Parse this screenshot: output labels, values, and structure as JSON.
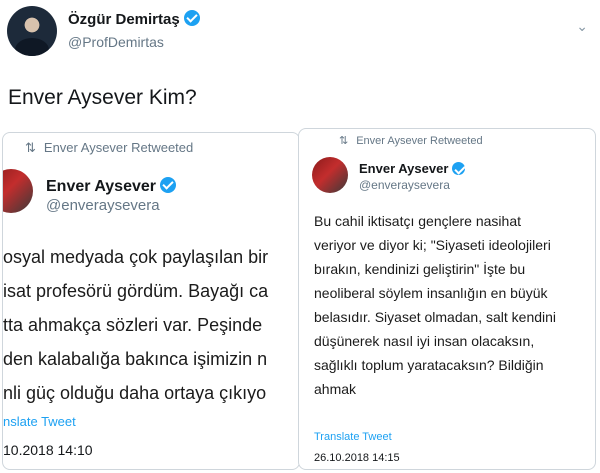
{
  "tweet": {
    "author_name": "Özgür Demirtaş",
    "author_handle": "@ProfDemirtas",
    "text": "Enver Aysever Kim?",
    "menu_icon": "chevron-down-icon"
  },
  "left_card": {
    "retweet_label": "Enver Aysever Retweeted",
    "author_name": "Enver Aysever",
    "author_handle": "@enveraysevera",
    "lines": [
      "osyal medyada çok paylaşılan bir",
      "isat profesörü gördüm. Bayağı ca",
      "tta ahmakça sözleri var. Peşinde",
      "den kalabalığa bakınca işimizin n",
      "nli güç olduğu daha ortaya çıkıyo"
    ],
    "translate_label": "nslate Tweet",
    "date": "10.2018 14:10"
  },
  "right_card": {
    "retweet_label": "Enver Aysever Retweeted",
    "author_name": "Enver Aysever",
    "author_handle": "@enveraysevera",
    "lines": [
      "Bu cahil iktisatçı gençlere nasihat",
      "veriyor ve diyor ki; \"Siyaseti ideolojileri",
      "bırakın, kendinizi geliştirin\" İşte bu",
      "neoliberal söylem insanlığın en büyük",
      "belasıdır. Siyaset olmadan, salt kendini",
      "düşünerek nasıl iyi insan olacaksın,",
      "sağlıklı toplum yaratacaksın? Bildiğin",
      "ahmak"
    ],
    "translate_label": "Translate Tweet",
    "date": "26.10.2018 14:15"
  }
}
